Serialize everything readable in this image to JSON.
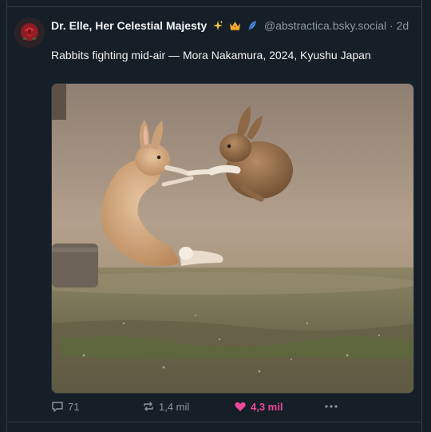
{
  "post": {
    "author": {
      "display_name": "Dr. Elle, Her Celestial Majesty",
      "emojis": [
        "sparkles-icon",
        "crown-icon",
        "feather-icon"
      ],
      "handle": "@abstractica.bsky.social",
      "separator": "·",
      "time": "2d",
      "avatar_icon": "rose-icon"
    },
    "text": "Rabbits fighting mid-air — Mora Nakamura, 2024, Kyushu Japan",
    "media": {
      "type": "photo",
      "subject": "rabbits-mid-air"
    },
    "actions": {
      "reply_count": "71",
      "repost_count": "1,4 mil",
      "like_count": "4,3 mil",
      "liked": true,
      "more_icon": "ellipsis-icon"
    }
  },
  "colors": {
    "background": "#161e27",
    "border": "#2e3b4a",
    "muted": "#8b98a5",
    "like_accent": "#ec4899"
  }
}
